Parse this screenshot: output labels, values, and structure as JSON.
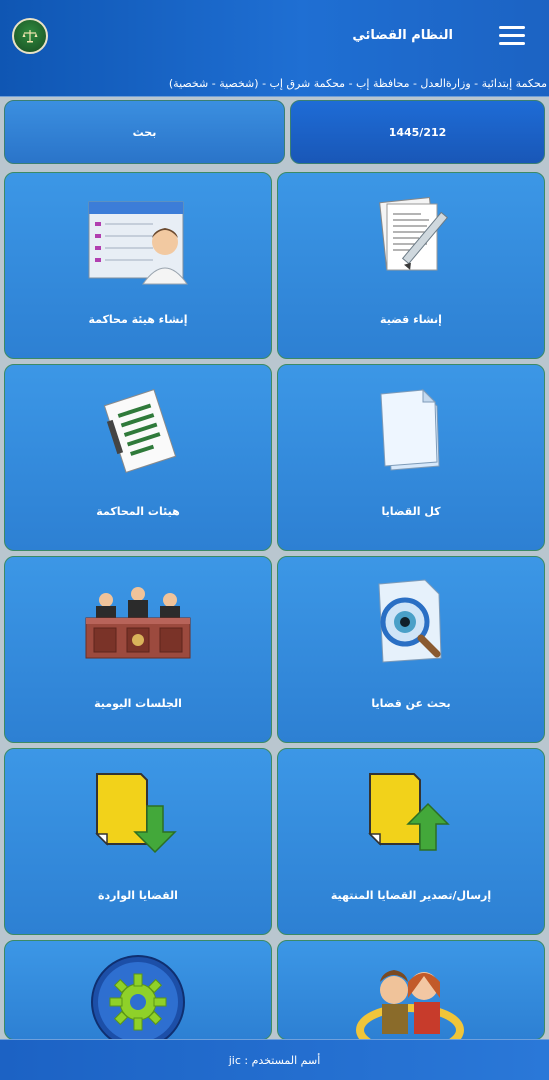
{
  "header": {
    "app_title": "النظام القضائي",
    "court_path": "محكمة إبتدائية - وزارةالعدل - محافظة إب - محكمة شرق إب - (شخصية - شخصية)",
    "menu_icon": "hamburger-icon",
    "logo_icon": "justice-scale-logo"
  },
  "top_actions": {
    "search_label": "بحث",
    "case_number": "1445/212"
  },
  "tiles": [
    {
      "label": "إنشاء قضية",
      "icon": "document-pen-icon"
    },
    {
      "label": "إنشاء هيئة محاكمة",
      "icon": "user-form-icon"
    },
    {
      "label": "كل القضايا",
      "icon": "documents-stack-icon"
    },
    {
      "label": "هيئات المحاكمة",
      "icon": "list-document-icon"
    },
    {
      "label": "بحث عن قضايا",
      "icon": "document-magnifier-icon"
    },
    {
      "label": "الجلسات اليومية",
      "icon": "courtroom-judges-icon"
    },
    {
      "label": "إرسال/تصدير القضايا المنتهية",
      "icon": "folder-upload-icon"
    },
    {
      "label": "القضايا الواردة",
      "icon": "folder-download-icon"
    },
    {
      "label": "",
      "icon": "users-badge-icon"
    },
    {
      "label": "",
      "icon": "gear-settings-icon"
    }
  ],
  "footer": {
    "username_label": "أسم المستخدم : jic"
  },
  "colors": {
    "primary": "#1f6fd3",
    "tile": "#3c97e6",
    "tile_border": "#3b8a66",
    "background": "#b9c6cf"
  }
}
